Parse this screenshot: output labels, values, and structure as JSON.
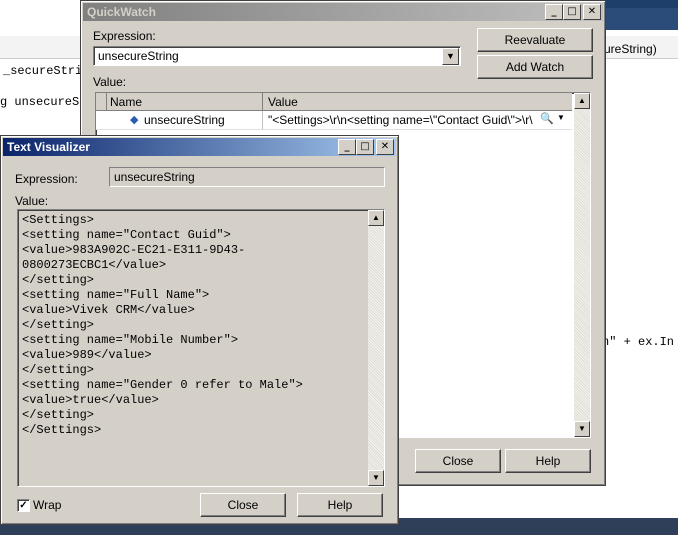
{
  "background": {
    "code_lines": [
      {
        "text": "_secureStri"
      },
      {
        "text": "g unsecureS"
      },
      {
        "text": "ureString)"
      },
      {
        "text": "n\" + ex.In"
      }
    ]
  },
  "quickwatch": {
    "title": "QuickWatch",
    "expression_label": "Expression:",
    "expression_value": "unsecureString",
    "reevaluate_label": "Reevaluate",
    "add_watch_label": "Add Watch",
    "value_label": "Value:",
    "columns": {
      "name": "Name",
      "value": "Value"
    },
    "row": {
      "name": "unsecureString",
      "value": "\"<Settings>\\r\\n<setting name=\\\"Contact Guid\\\">\\r\\"
    },
    "close_label": "Close",
    "help_label": "Help"
  },
  "visualizer": {
    "title": "Text Visualizer",
    "expression_label": "Expression:",
    "expression_value": "unsecureString",
    "value_label": "Value:",
    "lines": [
      "<Settings>",
      "<setting name=\"Contact Guid\">",
      "<value>983A902C-EC21-E311-9D43-",
      "0800273ECBC1</value>",
      "</setting>",
      "<setting name=\"Full Name\">",
      "<value>Vivek CRM</value>",
      "</setting>",
      "<setting name=\"Mobile Number\">",
      "<value>989</value>",
      "</setting>",
      "<setting name=\"Gender 0 refer to Male\">",
      "<value>true</value>",
      "</setting>",
      "</Settings>"
    ],
    "wrap_label": "Wrap",
    "wrap_checked": true,
    "close_label": "Close",
    "help_label": "Help"
  },
  "colors": {
    "title_active": "#0a246a",
    "title_inactive": "#808080",
    "window_face": "#d4d0c8"
  },
  "icons": {
    "tree_item": "diamond-icon",
    "magnifier": "magnifier-icon",
    "dropdown": "chevron-down-icon"
  }
}
